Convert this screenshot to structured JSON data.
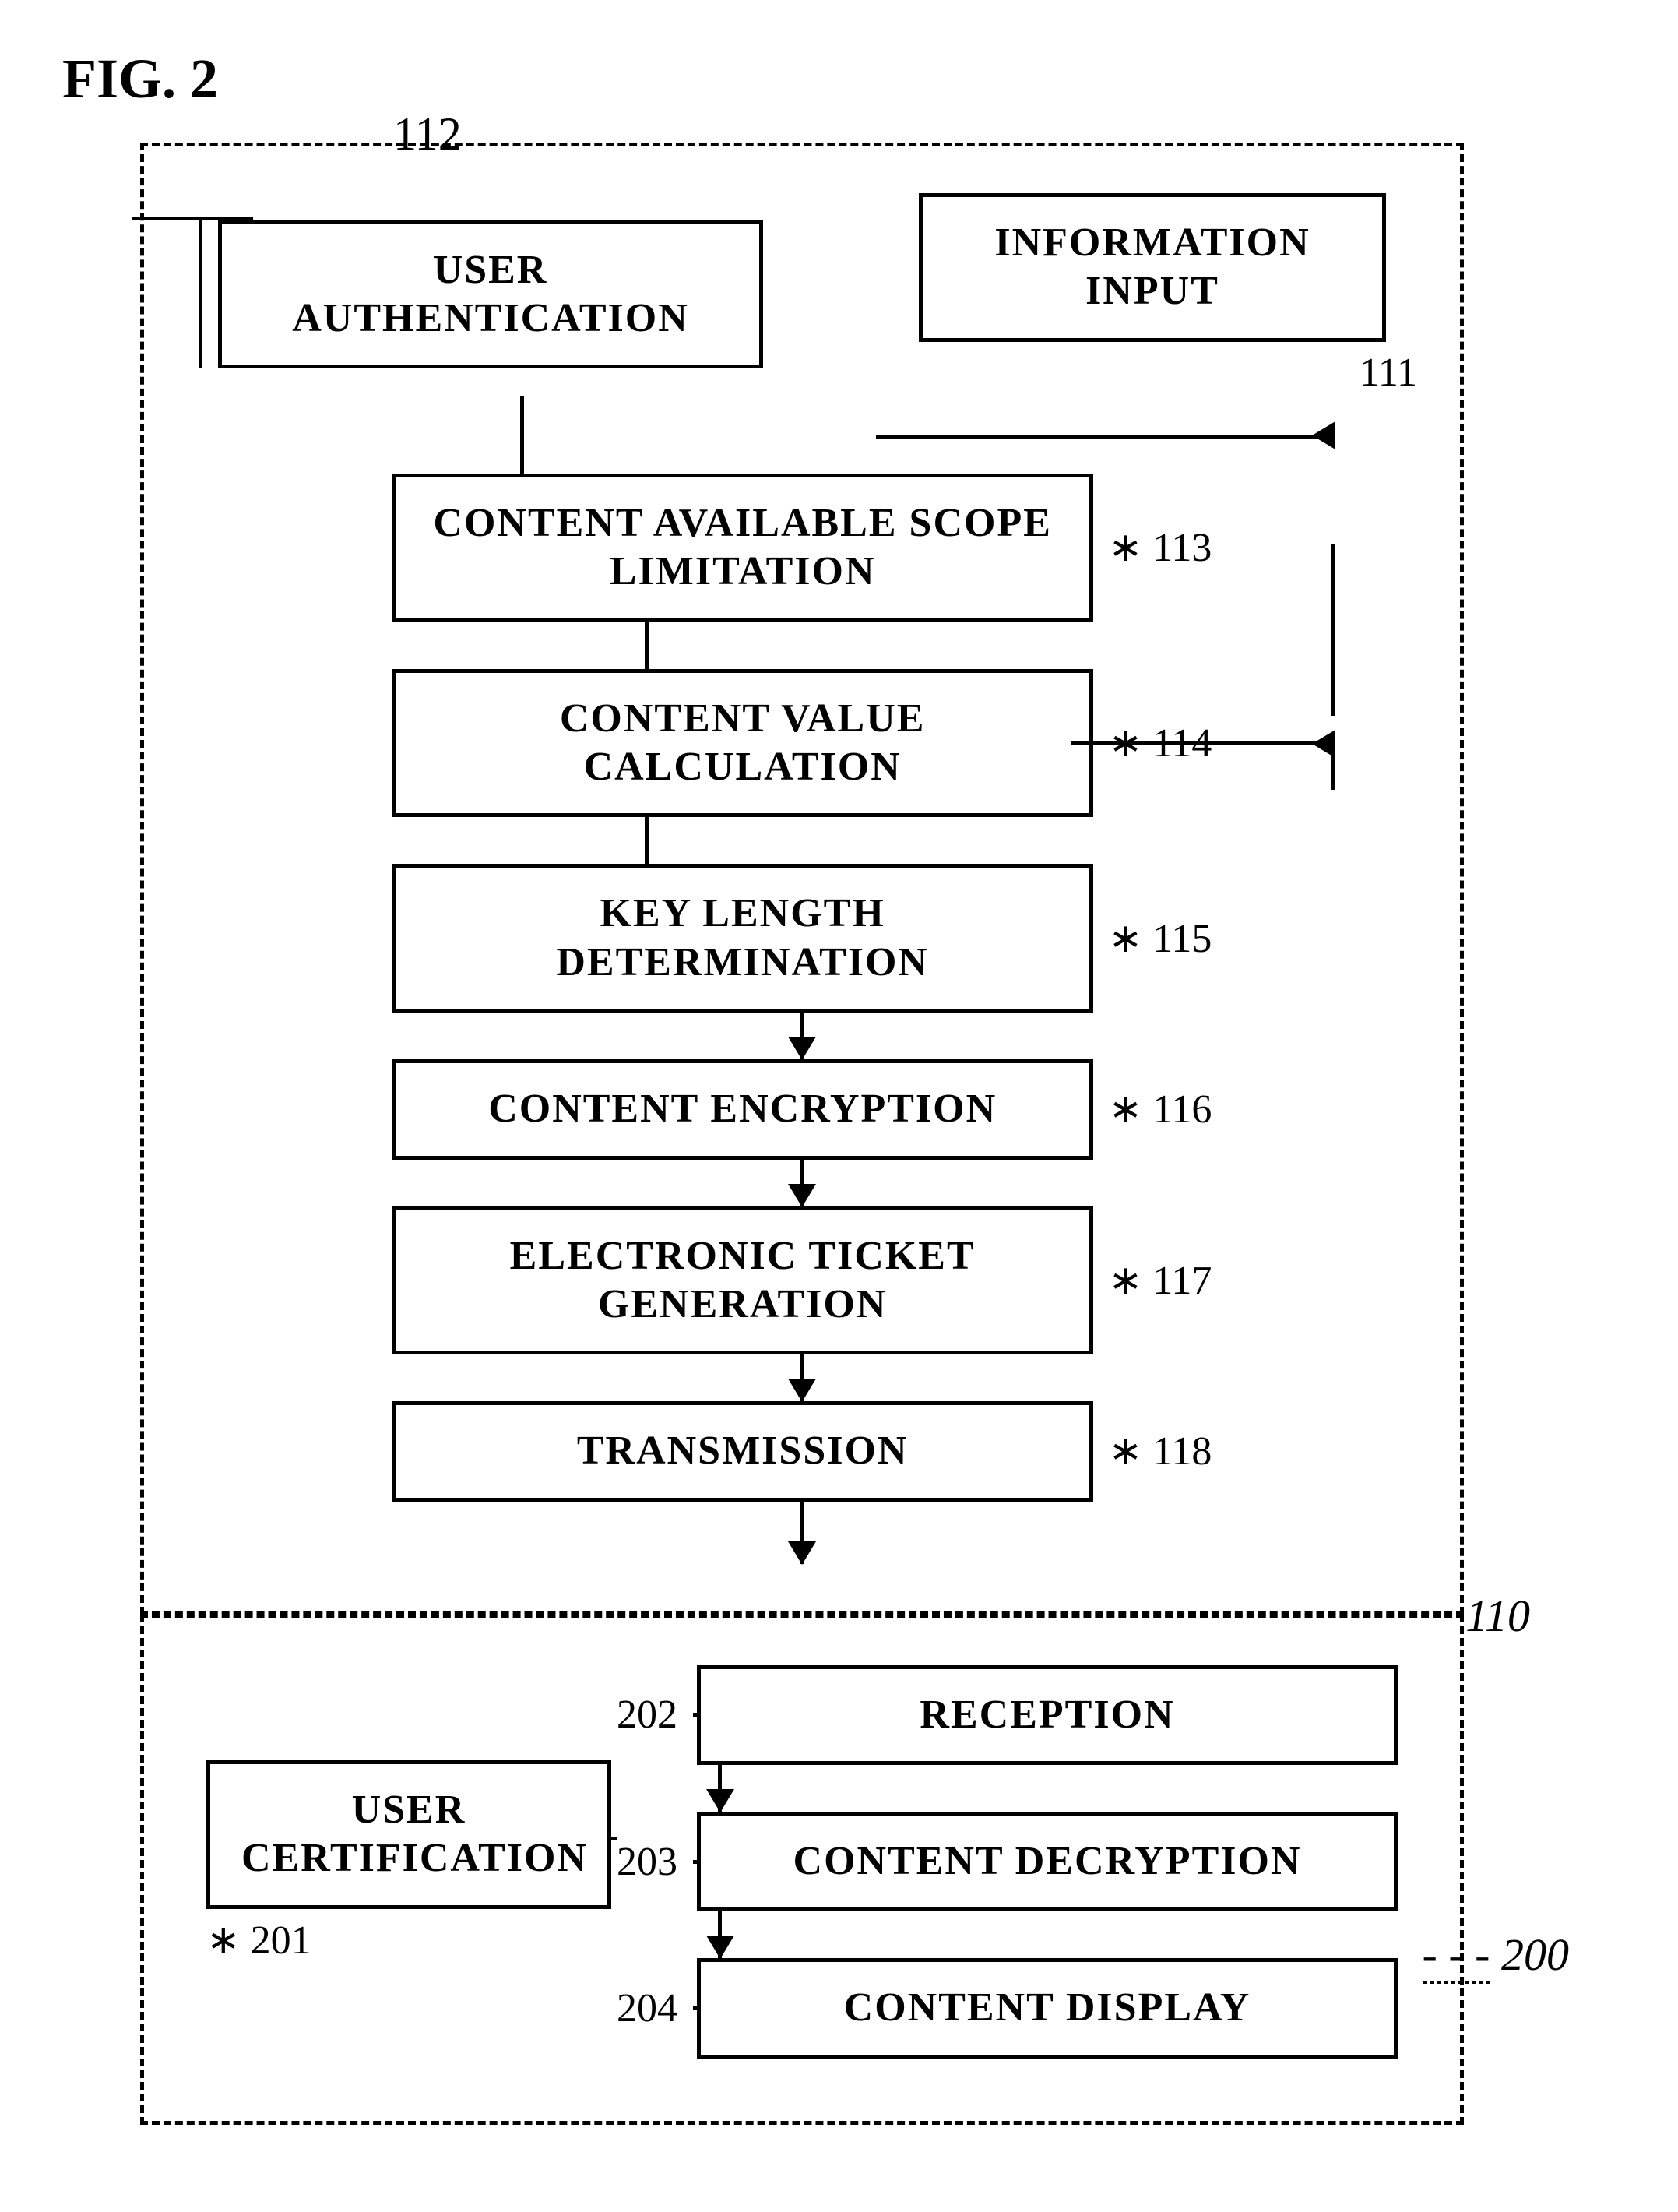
{
  "fig": {
    "label": "FIG. 2"
  },
  "labels": {
    "label_112": "112",
    "label_111": "111",
    "label_113": "113",
    "label_114": "114",
    "label_115": "115",
    "label_116": "116",
    "label_117": "117",
    "label_118": "118",
    "label_110": "110",
    "label_200": "200",
    "label_201": "201",
    "label_202": "202",
    "label_203": "203",
    "label_204": "204"
  },
  "boxes": {
    "user_authentication": "USER\nAUTHENTICATION",
    "information_input": "INFORMATION INPUT",
    "content_available_scope_limitation": "CONTENT AVAILABLE SCOPE\nLIMITATION",
    "content_value_calculation": "CONTENT VALUE\nCALCULATION",
    "key_length_determination": "KEY LENGTH DETERMINATION",
    "content_encryption": "CONTENT ENCRYPTION",
    "electronic_ticket_generation": "ELECTRONIC TICKET\nGENERATION",
    "transmission": "TRANSMISSION",
    "user_certification": "USER\nCERTIFICATION",
    "reception": "RECEPTION",
    "content_decryption": "CONTENT DECRYPTION",
    "content_display": "CONTENT DISPLAY"
  }
}
